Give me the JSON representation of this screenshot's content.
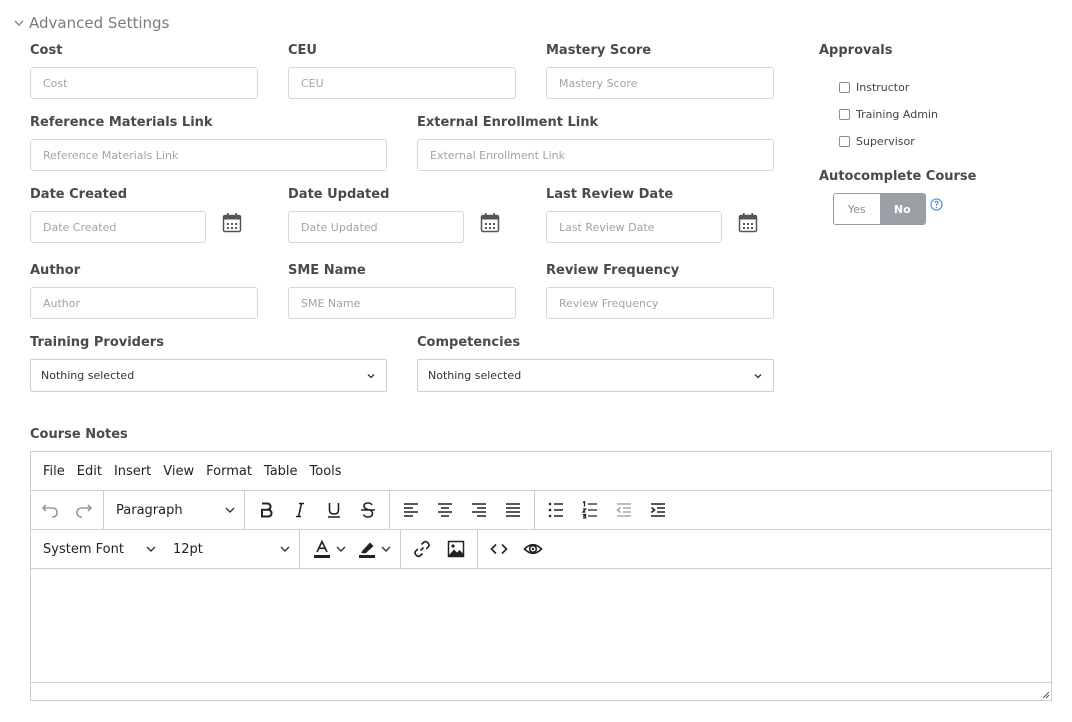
{
  "section": {
    "title": "Advanced Settings"
  },
  "fields": {
    "cost": {
      "label": "Cost",
      "placeholder": "Cost",
      "value": ""
    },
    "ceu": {
      "label": "CEU",
      "placeholder": "CEU",
      "value": ""
    },
    "mastery_score": {
      "label": "Mastery Score",
      "placeholder": "Mastery Score",
      "value": ""
    },
    "reference_link": {
      "label": "Reference Materials Link",
      "placeholder": "Reference Materials Link",
      "value": ""
    },
    "external_link": {
      "label": "External Enrollment Link",
      "placeholder": "External Enrollment Link",
      "value": ""
    },
    "date_created": {
      "label": "Date Created",
      "placeholder": "Date Created",
      "value": ""
    },
    "date_updated": {
      "label": "Date Updated",
      "placeholder": "Date Updated",
      "value": ""
    },
    "last_review_date": {
      "label": "Last Review Date",
      "placeholder": "Last Review Date",
      "value": ""
    },
    "author": {
      "label": "Author",
      "placeholder": "Author",
      "value": ""
    },
    "sme_name": {
      "label": "SME Name",
      "placeholder": "SME Name",
      "value": ""
    },
    "review_frequency": {
      "label": "Review Frequency",
      "placeholder": "Review Frequency",
      "value": ""
    }
  },
  "selects": {
    "training_providers": {
      "label": "Training Providers",
      "value": "Nothing selected"
    },
    "competencies": {
      "label": "Competencies",
      "value": "Nothing selected"
    }
  },
  "approvals": {
    "label": "Approvals",
    "options": [
      {
        "label": "Instructor",
        "checked": false
      },
      {
        "label": "Training Admin",
        "checked": false
      },
      {
        "label": "Supervisor",
        "checked": false
      }
    ]
  },
  "autocomplete": {
    "label": "Autocomplete Course",
    "yes": "Yes",
    "no": "No",
    "selected": "No"
  },
  "course_notes": {
    "label": "Course Notes",
    "menu": [
      "File",
      "Edit",
      "Insert",
      "View",
      "Format",
      "Table",
      "Tools"
    ],
    "block_format": "Paragraph",
    "font_family": "System Font",
    "font_size": "12pt",
    "content": ""
  },
  "colors": {
    "accent": "#4a90d9",
    "toggle_active": "#9aa0a5",
    "border": "#cccccc"
  },
  "icons": {
    "toolbar_row1": [
      "undo-icon",
      "redo-icon",
      "bold-icon",
      "italic-icon",
      "underline-icon",
      "strikethrough-icon",
      "align-left-icon",
      "align-center-icon",
      "align-right-icon",
      "align-justify-icon",
      "bullet-list-icon",
      "numbered-list-icon",
      "outdent-icon",
      "indent-icon"
    ],
    "toolbar_row2": [
      "text-color-icon",
      "highlight-icon",
      "link-icon",
      "image-icon",
      "code-icon",
      "preview-icon"
    ]
  }
}
